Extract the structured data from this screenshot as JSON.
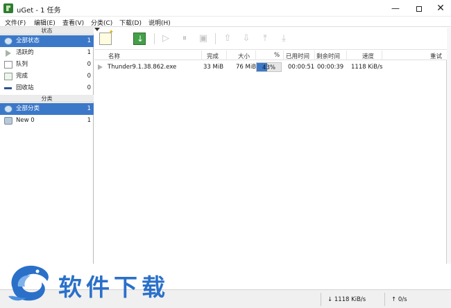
{
  "window": {
    "title": "uGet - 1 任务",
    "min_glyph": "—",
    "close_glyph": "✕"
  },
  "menu": [
    "文件(F)",
    "编辑(E)",
    "查看(V)",
    "分类(C)",
    "下载(D)",
    "说明(H)"
  ],
  "sidebar": {
    "status_header": "状态",
    "status_items": [
      {
        "label": "全部状态",
        "count": "1",
        "icon": "globe-icon",
        "selected": true
      },
      {
        "label": "活跃的",
        "count": "1",
        "icon": "play-icon",
        "selected": false
      },
      {
        "label": "队列",
        "count": "0",
        "icon": "queue-icon",
        "selected": false
      },
      {
        "label": "完成",
        "count": "0",
        "icon": "finished-icon",
        "selected": false
      },
      {
        "label": "回收站",
        "count": "0",
        "icon": "recycle-icon",
        "selected": false
      }
    ],
    "category_header": "分类",
    "category_items": [
      {
        "label": "全部分类",
        "count": "1",
        "icon": "globe-icon",
        "selected": true
      },
      {
        "label": "New 0",
        "count": "1",
        "icon": "folder-icon",
        "selected": false
      }
    ]
  },
  "toolbar": {
    "buttons": [
      "new-download",
      "new-menu",
      "batch-download",
      "start",
      "pause",
      "properties",
      "move-up",
      "move-down",
      "move-top",
      "move-bottom"
    ]
  },
  "columns": [
    "名称",
    "完成",
    "大小",
    "%",
    "已用时间",
    "剩余时间",
    "速度",
    "重试"
  ],
  "downloads": [
    {
      "name": "Thunder9.1.38.862.exe",
      "complete": "33 MiB",
      "size": "76 MiB",
      "percent": "43%",
      "progress": 0.43,
      "elapsed": "00:00:51",
      "remaining": "00:00:39",
      "speed": "1118 KiB/s",
      "retry": ""
    }
  ],
  "statusbar": {
    "download_speed": "↓ 1118 KiB/s",
    "upload_speed": "↑ 0/s"
  },
  "watermark": {
    "text": "软件下载"
  },
  "colors": {
    "selection": "#3c78c8",
    "watermark": "#2a70c9"
  }
}
